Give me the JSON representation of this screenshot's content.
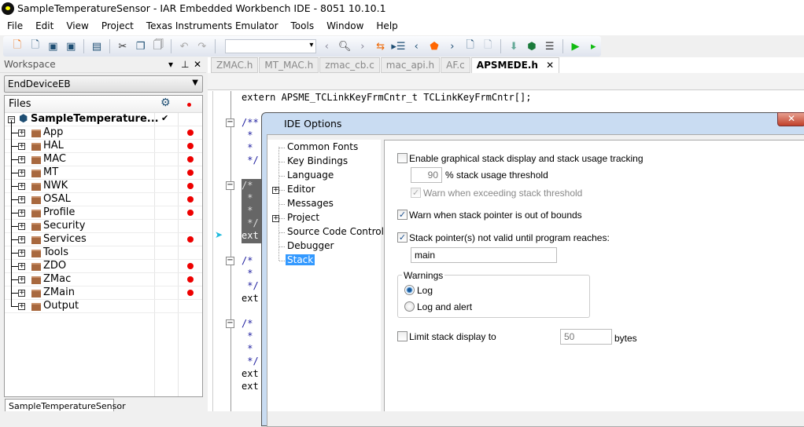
{
  "window": {
    "title": "SampleTemperatureSensor - IAR Embedded Workbench IDE - 8051 10.10.1"
  },
  "menu": [
    "File",
    "Edit",
    "View",
    "Project",
    "Texas Instruments Emulator",
    "Tools",
    "Window",
    "Help"
  ],
  "toolbar": {
    "icons": [
      "new-file-icon",
      "open-file-icon",
      "save-icon",
      "save-all-icon",
      "print-icon",
      "cut-icon",
      "copy-icon",
      "paste-icon",
      "undo-icon",
      "redo-icon",
      "search-combo",
      "back-icon",
      "find-icon",
      "forward-icon",
      "toggle-icon",
      "indent-icon",
      "prev-icon",
      "bookmark-icon",
      "next-icon",
      "prev-bookmark-icon",
      "next-bookmark-icon",
      "download-icon",
      "download-debug-icon",
      "breakpoint-icon",
      "debug-icon",
      "run-icon"
    ]
  },
  "workspace": {
    "title": "Workspace",
    "config": "EndDeviceEB",
    "files_header": "Files",
    "root": "SampleTemperature...",
    "items": [
      {
        "name": "App",
        "dot": true
      },
      {
        "name": "HAL",
        "dot": true
      },
      {
        "name": "MAC",
        "dot": true
      },
      {
        "name": "MT",
        "dot": true
      },
      {
        "name": "NWK",
        "dot": true
      },
      {
        "name": "OSAL",
        "dot": true
      },
      {
        "name": "Profile",
        "dot": true
      },
      {
        "name": "Security",
        "dot": false
      },
      {
        "name": "Services",
        "dot": true
      },
      {
        "name": "Tools",
        "dot": false
      },
      {
        "name": "ZDO",
        "dot": true
      },
      {
        "name": "ZMac",
        "dot": true
      },
      {
        "name": "ZMain",
        "dot": true
      },
      {
        "name": "Output",
        "dot": false
      }
    ],
    "bottom_tab": "SampleTemperatureSensor"
  },
  "editor": {
    "tabs": [
      "ZMAC.h",
      "MT_MAC.h",
      "zmac_cb.c",
      "mac_api.h",
      "AF.c",
      "APSMEDE.h"
    ],
    "active_tab": "APSMEDE.h",
    "first_line": "extern APSME_TCLinkKeyFrmCntr_t TCLinkKeyFrmCntr[];"
  },
  "dialog": {
    "title": "IDE Options",
    "tree": [
      "Common Fonts",
      "Key Bindings",
      "Language",
      "Editor",
      "Messages",
      "Project",
      "Source Code Control",
      "Debugger",
      "Stack"
    ],
    "selected": "Stack",
    "stack": {
      "enable_graphical": {
        "label": "Enable graphical stack display and stack usage tracking",
        "checked": false
      },
      "threshold_value": "90",
      "threshold_label": "% stack usage threshold",
      "warn_exceeding": {
        "label": "Warn when exceeding stack threshold",
        "checked": true,
        "disabled": true
      },
      "warn_out_of_bounds": {
        "label": "Warn when stack pointer is out of bounds",
        "checked": true
      },
      "not_valid_until": {
        "label": "Stack pointer(s) not valid until program reaches:",
        "checked": true
      },
      "program_point": "main",
      "warnings_group": "Warnings",
      "warnings": [
        {
          "label": "Log",
          "selected": true
        },
        {
          "label": "Log and alert",
          "selected": false
        }
      ],
      "limit": {
        "label": "Limit stack display to",
        "checked": false
      },
      "limit_value": "50",
      "limit_unit": "bytes"
    }
  }
}
